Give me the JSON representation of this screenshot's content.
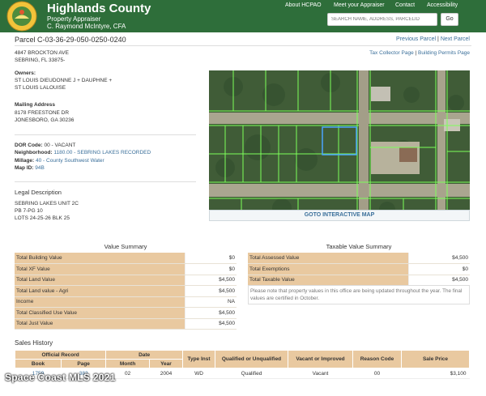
{
  "header": {
    "title": "Highlands County",
    "subtitle1": "Property Appraiser",
    "subtitle2": "C. Raymond McIntyre, CFA",
    "nav": [
      "About HCPAO",
      "Meet your Appraiser",
      "Contact",
      "Accessibility"
    ],
    "search_placeholder": "SEARCH NAME, ADDRESS, PARCELID",
    "go_label": "Go"
  },
  "parcel": {
    "title": "Parcel C-03-36-29-050-0250-0240",
    "prev": "Previous Parcel",
    "next": "Next Parcel",
    "pipe": "|",
    "address1": "4847 BROCKTON AVE",
    "address2": "SEBRING, FL 33875-",
    "tax_link": "Tax Collector Page",
    "permits_link": "Building Permits Page"
  },
  "owners": {
    "label": "Owners:",
    "line1": "ST LOUIS DIEUDONNE J + DAUPHNE +",
    "line2": "ST LOUIS LALOUISE"
  },
  "mailing": {
    "label": "Mailing Address",
    "line1": "8178 FREESTONE DR",
    "line2": "JONESBORO, GA 30236"
  },
  "details": {
    "dor_label": "DOR Code:",
    "dor_value": "00 - VACANT",
    "nbhd_label": "Neighborhood:",
    "nbhd_value": "1180.00 - SEBRING LAKES RECORDED",
    "millage_label": "Millage:",
    "millage_value": "40 - County Southwest Water",
    "mapid_label": "Map ID:",
    "mapid_value": "94B"
  },
  "legal": {
    "heading": "Legal Description",
    "line1": "SEBRING LAKES UNIT 2C",
    "line2": "PB 7-PG 10",
    "line3": "LOTS 24-25-26 BLK 25"
  },
  "map": {
    "button": "GOTO INTERACTIVE MAP"
  },
  "value_summary": {
    "title": "Value Summary",
    "rows": [
      {
        "k": "Total Building Value",
        "v": "$0"
      },
      {
        "k": "Total XF Value",
        "v": "$0"
      },
      {
        "k": "Total Land Value",
        "v": "$4,500"
      },
      {
        "k": "Total Land value - Agri",
        "v": "$4,500"
      },
      {
        "k": "Income",
        "v": "NA"
      },
      {
        "k": "Total Classified Use Value",
        "v": "$4,500"
      },
      {
        "k": "Total Just Value",
        "v": "$4,500"
      }
    ]
  },
  "taxable_summary": {
    "title": "Taxable Value Summary",
    "rows": [
      {
        "k": "Total Assessed Value",
        "v": "$4,500"
      },
      {
        "k": "Total Exemptions",
        "v": "$0"
      },
      {
        "k": "Total Taxable Value",
        "v": "$4,500"
      }
    ],
    "note": "Please note that property values in this office are being updated throughout the year. The final values are certified in October."
  },
  "sales": {
    "heading": "Sales History",
    "h_official": "Official Record",
    "h_date": "Date",
    "h_type": "Type Inst",
    "h_qualified": "Qualified or Unqualified",
    "h_vacant": "Vacant or Improved",
    "h_reason": "Reason Code",
    "h_price": "Sale Price",
    "h_book": "Book",
    "h_page": "Page",
    "h_month": "Month",
    "h_year": "Year",
    "rows": [
      {
        "book": "1759",
        "page": "382",
        "month": "02",
        "year": "2004",
        "type": "WD",
        "qualified": "Qualified",
        "vacant": "Vacant",
        "reason": "00",
        "price": "$3,100"
      }
    ]
  },
  "watermark": "Space Coast MLS 2021",
  "colors": {
    "header_green": "#2e6e3a",
    "table_header": "#e9c9a0",
    "link": "#3a6f9a",
    "parcel_outline": "#4aa3ff",
    "lot_lines": "#7dff5a"
  }
}
